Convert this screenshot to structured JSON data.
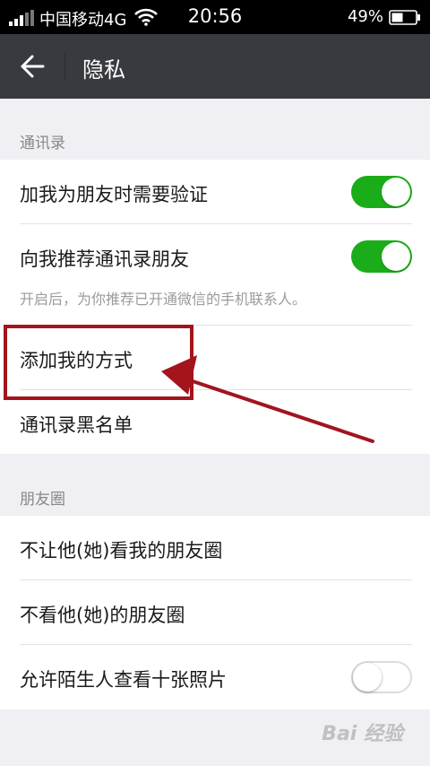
{
  "status_bar": {
    "carrier": "中国移动4G",
    "time": "20:56",
    "battery_percent": "49%"
  },
  "nav": {
    "title": "隐私"
  },
  "sections": {
    "contacts": {
      "title": "通讯录",
      "items": [
        {
          "label": "加我为朋友时需要验证",
          "toggle": true
        },
        {
          "label": "向我推荐通讯录朋友",
          "toggle": true,
          "hint": "开启后，为你推荐已开通微信的手机联系人。"
        },
        {
          "label": "添加我的方式"
        },
        {
          "label": "通讯录黑名单"
        }
      ]
    },
    "moments": {
      "title": "朋友圈",
      "items": [
        {
          "label": "不让他(她)看我的朋友圈"
        },
        {
          "label": "不看他(她)的朋友圈"
        },
        {
          "label": "允许陌生人查看十张照片",
          "toggle": false
        }
      ]
    }
  },
  "colors": {
    "accent_green": "#1aad19",
    "nav_bg": "#393a3f",
    "annotation_red": "#a3141c"
  },
  "watermark": "Bai 经验"
}
